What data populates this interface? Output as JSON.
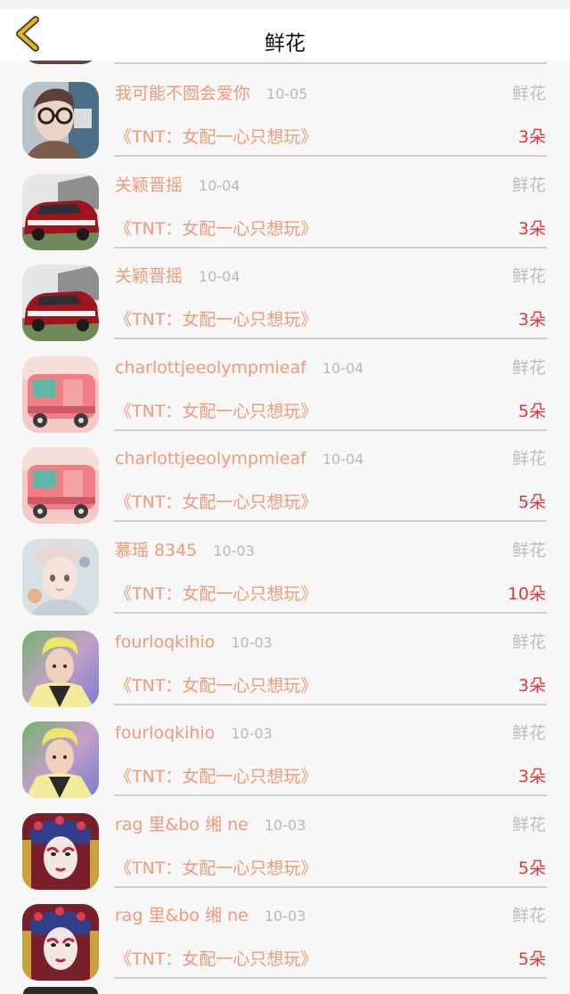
{
  "header": {
    "title": "鲜花",
    "back_icon": "chevron-left-icon",
    "accent_color": "#e8b21e"
  },
  "colors": {
    "name": "#ef9a78",
    "count": "#e2373e",
    "muted": "#b9b9b9"
  },
  "rows": [
    {
      "name": "我可能不囫会爱你",
      "date": "10-05",
      "gift": "鲜花",
      "book": "《TNT：女配一心只想玩》",
      "count": "3朵",
      "avatar": "avatar-glasses"
    },
    {
      "name": "关颖晋摇",
      "date": "10-04",
      "gift": "鲜花",
      "book": "《TNT：女配一心只想玩》",
      "count": "3朵",
      "avatar": "avatar-red-car"
    },
    {
      "name": "关颖晋摇",
      "date": "10-04",
      "gift": "鲜花",
      "book": "《TNT：女配一心只想玩》",
      "count": "3朵",
      "avatar": "avatar-red-car"
    },
    {
      "name": "charlottjeeolympmieaf",
      "date": "10-04",
      "gift": "鲜花",
      "book": "《TNT：女配一心只想玩》",
      "count": "5朵",
      "avatar": "avatar-pink-van"
    },
    {
      "name": "charlottjeeolympmieaf",
      "date": "10-04",
      "gift": "鲜花",
      "book": "《TNT：女配一心只想玩》",
      "count": "5朵",
      "avatar": "avatar-pink-van"
    },
    {
      "name": "慕瑶 8345",
      "date": "10-03",
      "gift": "鲜花",
      "book": "《TNT：女配一心只想玩》",
      "count": "10朵",
      "avatar": "avatar-anime-girl"
    },
    {
      "name": "fourloqkihio",
      "date": "10-03",
      "gift": "鲜花",
      "book": "《TNT：女配一心只想玩》",
      "count": "3朵",
      "avatar": "avatar-blond-man"
    },
    {
      "name": "fourloqkihio",
      "date": "10-03",
      "gift": "鲜花",
      "book": "《TNT：女配一心只想玩》",
      "count": "3朵",
      "avatar": "avatar-blond-man"
    },
    {
      "name": "rag 里&bo 缃 ne",
      "date": "10-03",
      "gift": "鲜花",
      "book": "《TNT：女配一心只想玩》",
      "count": "5朵",
      "avatar": "avatar-opera"
    },
    {
      "name": "rag 里&bo 缃 ne",
      "date": "10-03",
      "gift": "鲜花",
      "book": "《TNT：女配一心只想玩》",
      "count": "5朵",
      "avatar": "avatar-opera"
    }
  ]
}
